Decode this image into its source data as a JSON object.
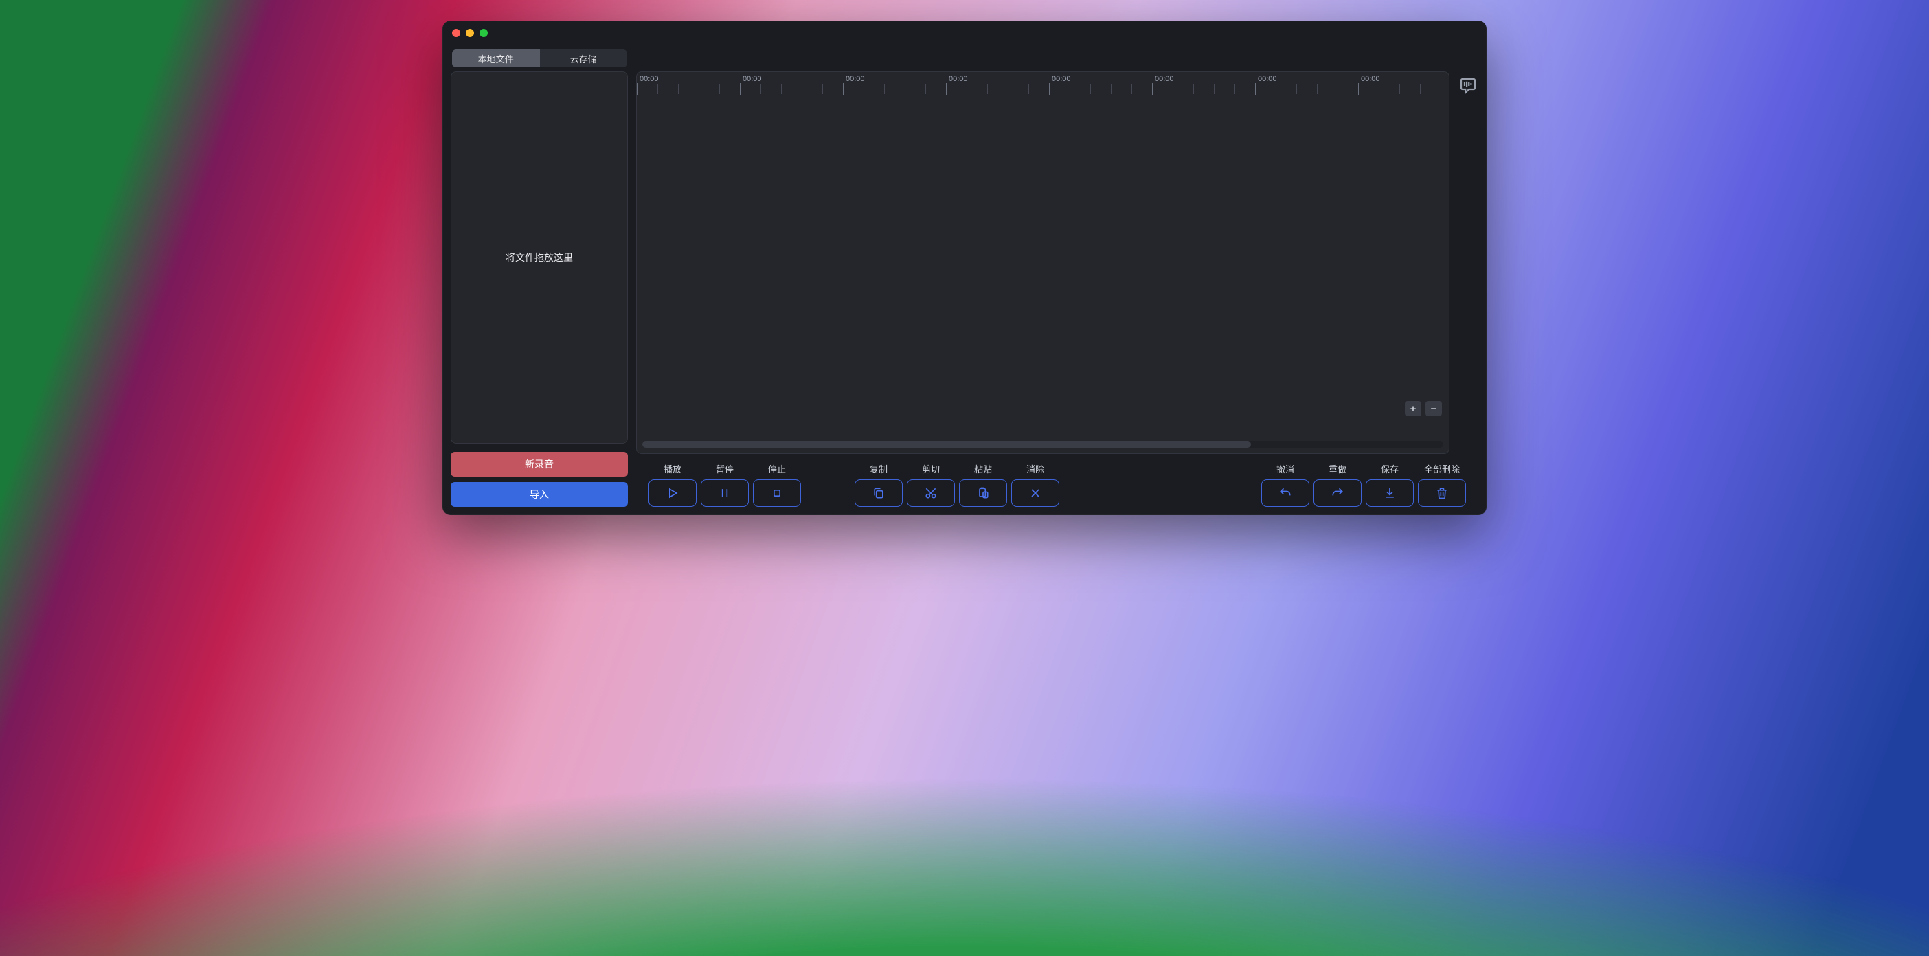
{
  "tabs": {
    "local": "本地文件",
    "cloud": "云存储"
  },
  "sidebar": {
    "dropzone": "将文件拖放这里",
    "new_recording": "新录音",
    "import": "导入"
  },
  "timeline": {
    "ticks": [
      "00:00",
      "00:00",
      "00:00",
      "00:00",
      "00:00",
      "00:00",
      "00:00",
      "00:00"
    ]
  },
  "toolbar": {
    "play": "播放",
    "pause": "暂停",
    "stop": "停止",
    "copy": "复制",
    "cut": "剪切",
    "paste": "粘贴",
    "clear": "消除",
    "undo": "撤消",
    "redo": "重做",
    "save": "保存",
    "delete_all": "全部删除"
  },
  "zoom": {
    "in": "+",
    "out": "−"
  }
}
